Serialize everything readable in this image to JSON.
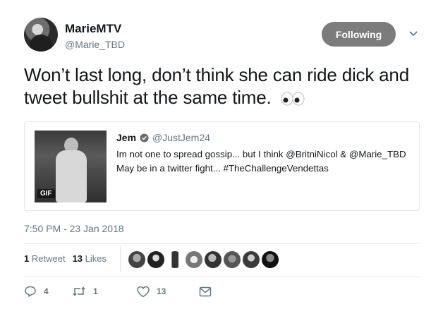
{
  "author": {
    "display_name": "MarieMTV",
    "handle": "@Marie_TBD"
  },
  "follow_button": {
    "label": "Following"
  },
  "tweet": {
    "text": "Won’t last long, don’t think she can ride dick and tweet bullshit at the same time."
  },
  "quoted_tweet": {
    "name": "Jem",
    "handle": "@JustJem24",
    "text": "Im not one to spread gossip... but I think @BritniNicol & @Marie_TBD May be in a twitter fight... #TheChallengeVendettas",
    "media_badge": "GIF"
  },
  "timestamp": "7:50 PM - 23 Jan 2018",
  "stats": {
    "retweets_count": "1",
    "retweets_label": "Retweet",
    "likes_count": "13",
    "likes_label": "Likes"
  },
  "actions": {
    "reply_count": "4",
    "retweet_count": "1",
    "like_count": "13"
  },
  "colors": {
    "follow_button": "#7c7c7c",
    "secondary_text": "#657786",
    "border": "#e1e8ed"
  }
}
